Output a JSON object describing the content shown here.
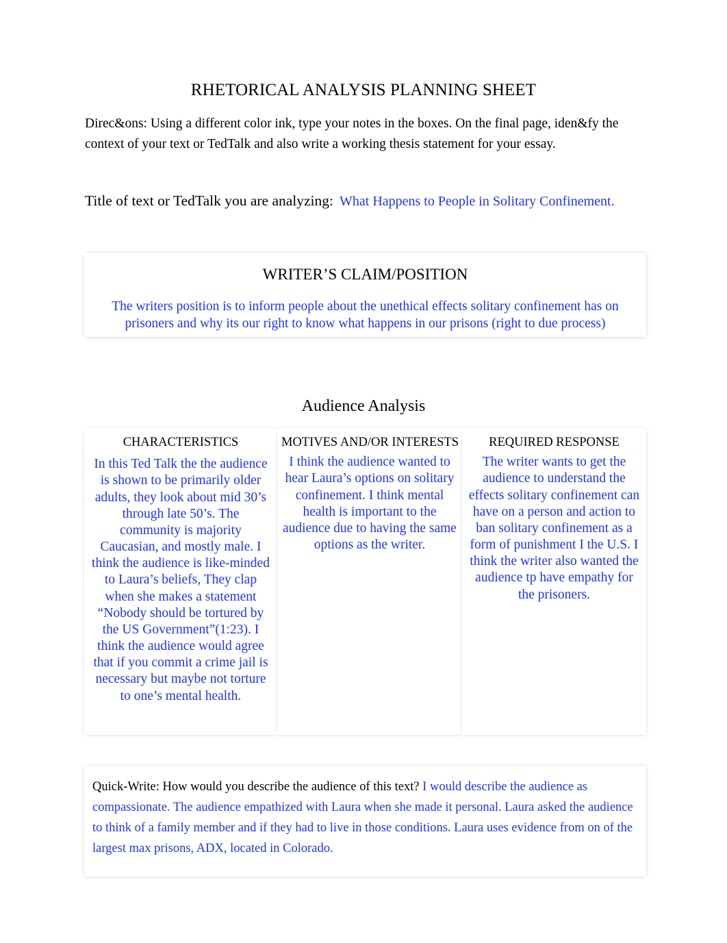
{
  "document": {
    "title": "RHETORICAL ANALYSIS PLANNING SHEET",
    "directions": "Direc&ons: Using a different color ink, type your notes in the boxes. On the final page, iden&fy the context of your text or TedTalk and also write a working thesis statement for your essay.",
    "ink_color": "#1f35e8",
    "text_color": "#000000"
  },
  "title_field": {
    "label": "Title of text or TedTalk you are analyzing:",
    "value": "What Happens to People in Solitary Confinement."
  },
  "claim": {
    "heading": "WRITER’S CLAIM/POSITION",
    "value": "The writers position is to inform people about the unethical effects solitary confinement has on prisoners and why its our right to know what happens in our prisons (right to due process)"
  },
  "audience_analysis": {
    "heading": "Audience Analysis",
    "columns": [
      {
        "header": "CHARACTERISTICS",
        "value": "In this Ted Talk the the audience is shown to be primarily older adults, they look about mid 30’s through late 50’s. The community is majority Caucasian, and mostly male. I think the audience is like-minded to Laura’s beliefs, They clap when she makes a statement “Nobody should be tortured by the US Government”(1:23). I think the audience would agree that if you commit a crime jail is necessary but maybe not torture to one’s mental health."
      },
      {
        "header": "MOTIVES AND/OR INTERESTS",
        "value": "I think the audience wanted to hear Laura’s options on solitary confinement. I think mental health is important to the audience due to having the same options as the writer."
      },
      {
        "header": "REQUIRED RESPONSE",
        "value": "The writer wants to get the audience to understand the effects solitary confinement can have on a person and action to ban solitary confinement as a form of punishment I the U.S. I think the writer also wanted the audience tp have empathy for the prisoners."
      }
    ]
  },
  "quick_write": {
    "prompt": "Quick-Write: How would you describe the audience of this text?",
    "value": "I would describe the audience as compassionate. The audience empathized with Laura when she made it personal. Laura asked the audience to think of a family member and if they had to live in those conditions. Laura uses evidence from on of the largest max prisons, ADX, located in Colorado."
  }
}
